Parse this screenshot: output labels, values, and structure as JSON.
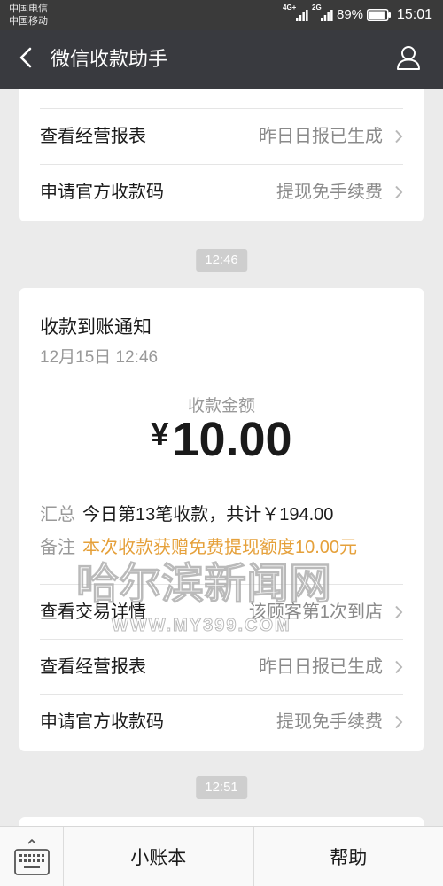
{
  "status_bar": {
    "carrier_1": "中国电信",
    "carrier_2": "中国移动",
    "network_1": "4G+",
    "network_2": "2G",
    "battery": "89%",
    "battery_level": 0.89,
    "time": "15:01"
  },
  "header": {
    "title": "微信收款助手"
  },
  "feed": {
    "prev_card": {
      "rows": [
        {
          "label": "查看经营报表",
          "value": "昨日日报已生成"
        },
        {
          "label": "申请官方收款码",
          "value": "提现免手续费"
        }
      ]
    },
    "timestamp_1": "12:46",
    "payment_card": {
      "title": "收款到账通知",
      "date": "12月15日 12:46",
      "amount_label": "收款金额",
      "currency": "¥",
      "amount": "10.00",
      "summary_label": "汇总",
      "summary_value": "今日第13笔收款，共计￥194.00",
      "note_label": "备注",
      "note_value": "本次收款获赠免费提现额度10.00元",
      "rows": [
        {
          "label": "查看交易详情",
          "value": "该顾客第1次到店"
        },
        {
          "label": "查看经营报表",
          "value": "昨日日报已生成"
        },
        {
          "label": "申请官方收款码",
          "value": "提现免手续费"
        }
      ]
    },
    "timestamp_2": "12:51"
  },
  "bottom_bar": {
    "menu_1": "小账本",
    "menu_2": "帮助"
  },
  "watermark": {
    "title": "哈尔滨新闻网",
    "url": "WWW.MY399.COM"
  },
  "icons": {
    "back": "chevron-left-icon",
    "profile": "person-icon",
    "row_arrow": "chevron-right-icon",
    "keyboard": "keyboard-icon",
    "signal": "signal-icon",
    "battery": "battery-icon"
  },
  "colors": {
    "status_bg": "#3a3a3a",
    "header_bg": "#393a3f",
    "page_bg": "#ebebeb",
    "note_accent": "#e5a03a",
    "timestamp_bg": "#cecece"
  }
}
